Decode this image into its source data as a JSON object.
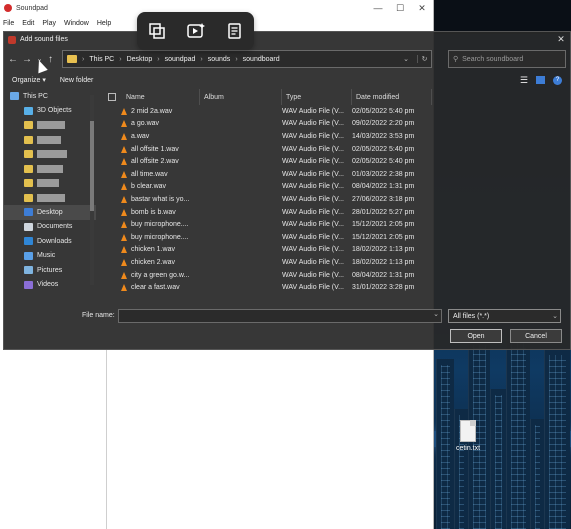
{
  "soundpad": {
    "title": "Soundpad",
    "menu": [
      "File",
      "Edit",
      "Play",
      "Window",
      "Help"
    ]
  },
  "media_toolbar": {
    "icons": [
      "screen-record-icon",
      "video-edit-icon",
      "notes-icon"
    ]
  },
  "dialog": {
    "title": "Add sound files",
    "address": [
      "This PC",
      "Desktop",
      "soundpad",
      "sounds",
      "soundboard"
    ],
    "search_placeholder": "Search soundboard",
    "organize_label": "Organize ▾",
    "new_folder_label": "New folder",
    "nav": {
      "this_pc": "This PC",
      "items": [
        {
          "label": "3D Objects",
          "icon": "3d-objects-icon",
          "blurred": false
        },
        {
          "label": "",
          "icon": "folder-icon",
          "blurred": true
        },
        {
          "label": "",
          "icon": "folder-icon",
          "blurred": true
        },
        {
          "label": "",
          "icon": "folder-icon",
          "blurred": true
        },
        {
          "label": "",
          "icon": "folder-icon",
          "blurred": true
        },
        {
          "label": "",
          "icon": "folder-icon",
          "blurred": true
        },
        {
          "label": "",
          "icon": "folder-icon",
          "blurred": true
        },
        {
          "label": "Desktop",
          "icon": "desktop-icon",
          "blurred": false,
          "selected": true
        },
        {
          "label": "Documents",
          "icon": "documents-icon",
          "blurred": false
        },
        {
          "label": "Downloads",
          "icon": "downloads-icon",
          "blurred": false
        },
        {
          "label": "Music",
          "icon": "music-icon",
          "blurred": false
        },
        {
          "label": "Pictures",
          "icon": "pictures-icon",
          "blurred": false
        },
        {
          "label": "Videos",
          "icon": "videos-icon",
          "blurred": false
        }
      ]
    },
    "columns": {
      "name": "Name",
      "album": "Album",
      "type": "Type",
      "date": "Date modified"
    },
    "files": [
      {
        "name": "2 mid 2a.wav",
        "type": "WAV Audio File (V...",
        "date": "02/05/2022 5:40 pm"
      },
      {
        "name": "a go.wav",
        "type": "WAV Audio File (V...",
        "date": "09/02/2022 2:20 pm"
      },
      {
        "name": "a.wav",
        "type": "WAV Audio File (V...",
        "date": "14/03/2022 3:53 pm"
      },
      {
        "name": "all offsite 1.wav",
        "type": "WAV Audio File (V...",
        "date": "02/05/2022 5:40 pm"
      },
      {
        "name": "all offsite 2.wav",
        "type": "WAV Audio File (V...",
        "date": "02/05/2022 5:40 pm"
      },
      {
        "name": "all time.wav",
        "type": "WAV Audio File (V...",
        "date": "01/03/2022 2:38 pm"
      },
      {
        "name": "b clear.wav",
        "type": "WAV Audio File (V...",
        "date": "08/04/2022 1:31 pm"
      },
      {
        "name": "bastar what is yo...",
        "type": "WAV Audio File (V...",
        "date": "27/06/2022 3:18 pm"
      },
      {
        "name": "bomb is b.wav",
        "type": "WAV Audio File (V...",
        "date": "28/01/2022 5:27 pm"
      },
      {
        "name": "buy microphone....",
        "type": "WAV Audio File (V...",
        "date": "15/12/2021 2:05 pm"
      },
      {
        "name": "buy microphone....",
        "type": "WAV Audio File (V...",
        "date": "15/12/2021 2:05 pm"
      },
      {
        "name": "chicken 1.wav",
        "type": "WAV Audio File (V...",
        "date": "18/02/2022 1:13 pm"
      },
      {
        "name": "chicken 2.wav",
        "type": "WAV Audio File (V...",
        "date": "18/02/2022 1:13 pm"
      },
      {
        "name": "city a green go.w...",
        "type": "WAV Audio File (V...",
        "date": "08/04/2022 1:31 pm"
      },
      {
        "name": "clear a fast.wav",
        "type": "WAV Audio File (V...",
        "date": "31/01/2022 3:28 pm"
      }
    ],
    "file_name_label": "File name:",
    "file_name_value": "",
    "filter_value": "All files (*.*)",
    "open_label": "Open",
    "cancel_label": "Cancel"
  },
  "desktop": {
    "file_label": "cetin.txt"
  }
}
